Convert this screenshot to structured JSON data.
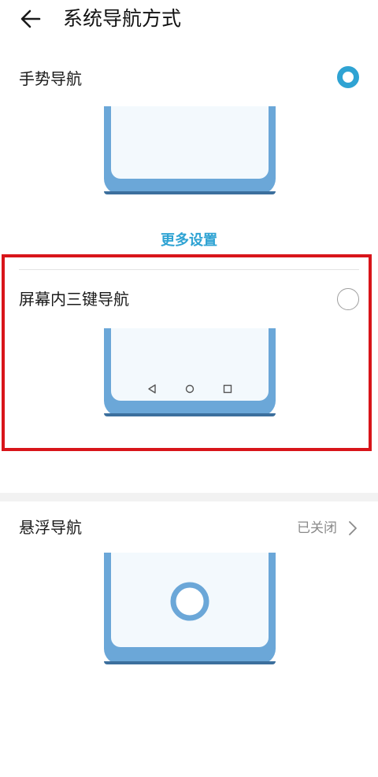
{
  "header": {
    "title": "系统导航方式",
    "back_icon": "back-arrow-icon"
  },
  "options": {
    "gesture": {
      "label": "手势导航",
      "selected": true
    },
    "more_settings_label": "更多设置",
    "three_key": {
      "label": "屏幕内三键导航",
      "selected": false,
      "nav_icons": [
        "back-triangle-icon",
        "home-circle-icon",
        "recent-square-icon"
      ]
    },
    "floating": {
      "label": "悬浮导航",
      "status": "已关闭"
    }
  },
  "colors": {
    "accent": "#2fa3d3",
    "phone_frame": "#6ba7d8",
    "phone_screen": "#f3f9fd",
    "highlight": "#d8151a"
  }
}
